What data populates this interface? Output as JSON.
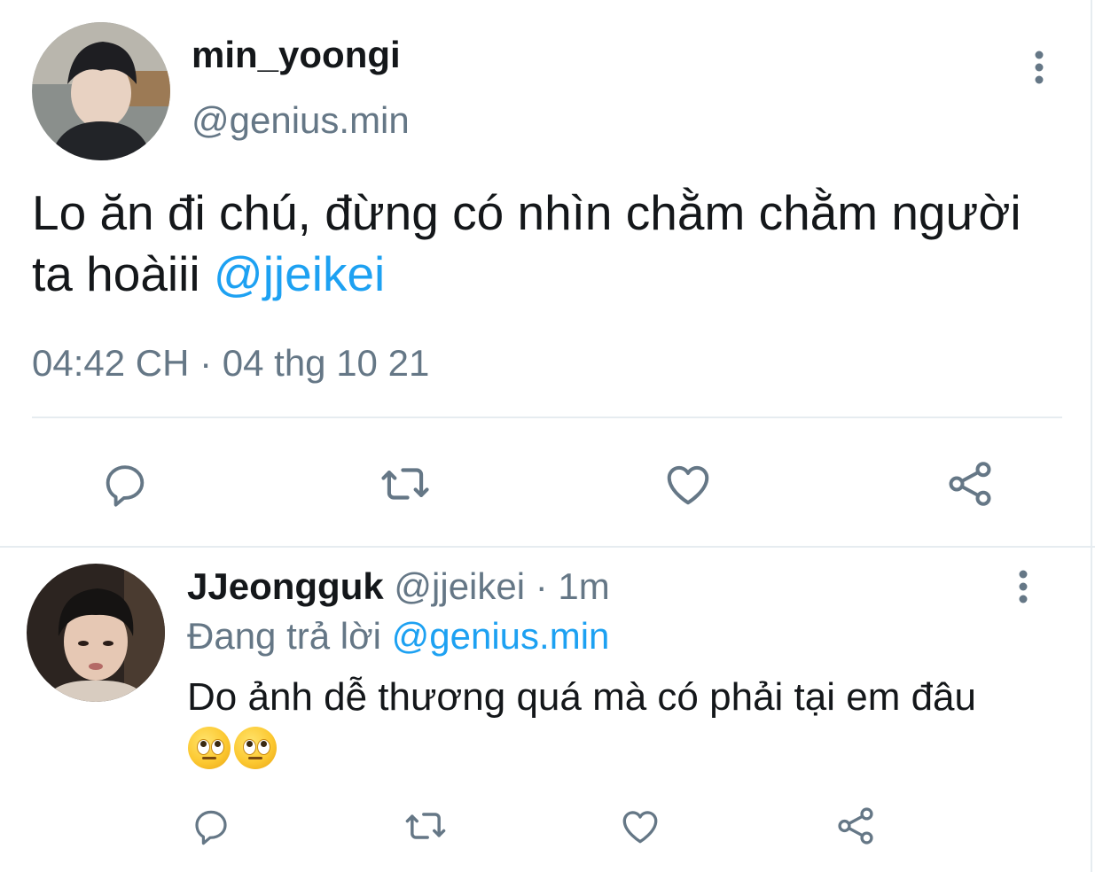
{
  "main_tweet": {
    "display_name": "min_yoongi",
    "handle": "@genius.min",
    "text": "Lo ăn đi chú, đừng có nhìn chằm chằm người ta hoàiii ",
    "mention": "@jjeikei",
    "timestamp": "04:42 CH · 04 thg 10 21",
    "actions": [
      "reply-icon",
      "retweet-icon",
      "like-icon",
      "share-icon"
    ]
  },
  "reply_tweet": {
    "display_name": "JJeongguk",
    "handle_time": "@jjeikei · 1m",
    "replying_prefix": "Đang trả lời ",
    "replying_to": "@genius.min",
    "text": "Do ảnh dễ thương quá mà có phải tại em đâu",
    "emojis": [
      "face-with-rolling-eyes",
      "face-with-rolling-eyes"
    ],
    "actions": [
      "reply-icon",
      "retweet-icon",
      "like-icon",
      "share-icon"
    ]
  },
  "colors": {
    "link": "#1da1f2",
    "muted": "#657786",
    "icon": "#657786",
    "divider": "#e6ecf0"
  }
}
